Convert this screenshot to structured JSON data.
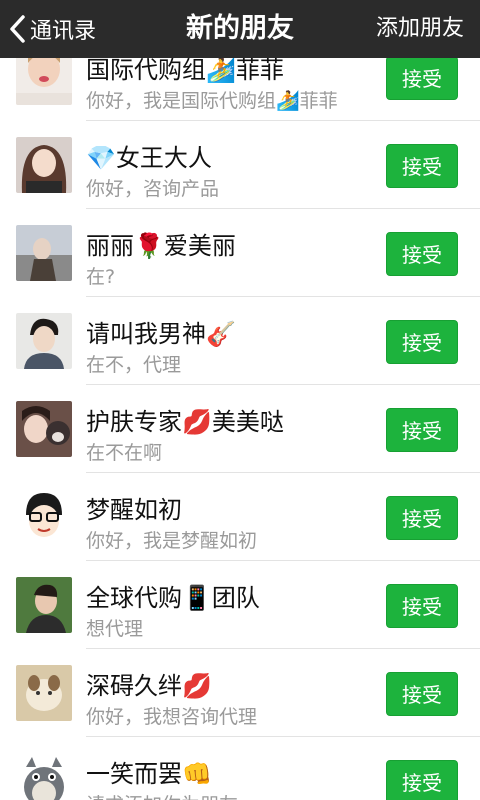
{
  "header": {
    "back_label": "通讯录",
    "title": "新的朋友",
    "action_label": "添加朋友"
  },
  "accept_label": "接受",
  "colors": {
    "navbar": "#2b2b2b",
    "accept_button": "#1db33d",
    "message_text": "#9a9a9a"
  },
  "requests": [
    {
      "name": "国际代购组🏄菲菲",
      "message": "你好，我是国际代购组🏄菲菲"
    },
    {
      "name": "💎女王大人",
      "message": "你好，咨询产品"
    },
    {
      "name": "丽丽🌹爱美丽",
      "message": "在?"
    },
    {
      "name": "请叫我男神🎸",
      "message": "在不，代理"
    },
    {
      "name": "护肤专家💋美美哒",
      "message": "在不在啊"
    },
    {
      "name": "梦醒如初",
      "message": "你好，我是梦醒如初"
    },
    {
      "name": "全球代购📱团队",
      "message": "想代理"
    },
    {
      "name": "深碍久绊💋",
      "message": "你好，我想咨询代理"
    },
    {
      "name": "一笑而罢👊",
      "message": "请求添加你为朋友"
    }
  ]
}
